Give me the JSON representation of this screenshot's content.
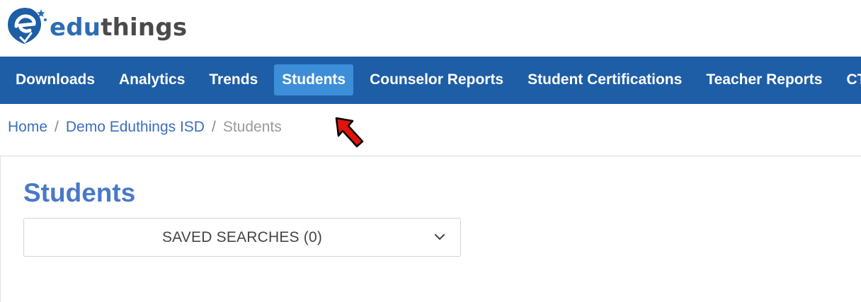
{
  "brand": {
    "logo_part1": "edu",
    "logo_part2": "things",
    "icon": "eduthings-logo-icon"
  },
  "nav": {
    "items": [
      {
        "label": "Downloads"
      },
      {
        "label": "Analytics"
      },
      {
        "label": "Trends"
      },
      {
        "label": "Students",
        "active": true
      },
      {
        "label": "Counselor Reports"
      },
      {
        "label": "Student Certifications"
      },
      {
        "label": "Teacher Reports"
      },
      {
        "label": "CT"
      }
    ]
  },
  "breadcrumb": {
    "home": "Home",
    "district": "Demo Eduthings ISD",
    "current": "Students",
    "separator": "/"
  },
  "main": {
    "title": "Students",
    "saved_searches_label": "SAVED SEARCHES (0)"
  },
  "colors": {
    "nav_bg": "#1e5ea6",
    "nav_active": "#3d8ed9",
    "title": "#4a78c8",
    "link": "#3c6ec0",
    "pointer": "#e3120b"
  },
  "icons": {
    "chevron": "chevron-down-icon",
    "pointer": "red-arrow-pointer-icon"
  }
}
